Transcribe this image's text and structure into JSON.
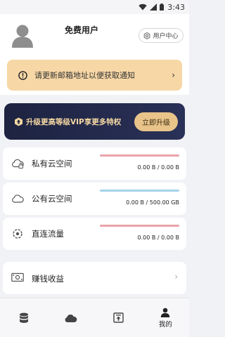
{
  "status_bar": {
    "time": "3:43",
    "icons": [
      "wifi-icon",
      "signal-icon",
      "battery-icon"
    ]
  },
  "profile": {
    "username": "免费用户",
    "user_center_label": "用户中心"
  },
  "notice": {
    "text": "请更新邮箱地址以便获取通知",
    "icon": "exclamation-circle-icon"
  },
  "vip_banner": {
    "text": "升级更高等级VIP享更多特权",
    "button_label": "立即升级"
  },
  "storage": [
    {
      "label": "私有云空间",
      "usage": "0.00 B / 0.00 B",
      "bar_color": "#e9a3a8",
      "fill": 1.0,
      "icon": "private-cloud-icon"
    },
    {
      "label": "公有云空间",
      "usage": "0.00 B / 500.00 GB",
      "bar_color": "#a4d2ea",
      "fill": 1.0,
      "icon": "cloud-icon"
    },
    {
      "label": "直连流量",
      "usage": "0.00 B / 0.00 B",
      "bar_color": "#e9a3a8",
      "fill": 1.0,
      "icon": "traffic-icon"
    }
  ],
  "earnings": {
    "label": "赚钱收益",
    "icon": "money-icon"
  },
  "tabs": [
    {
      "icon": "database-icon",
      "label": ""
    },
    {
      "icon": "cloud-icon",
      "label": ""
    },
    {
      "icon": "upload-icon",
      "label": ""
    },
    {
      "icon": "person-icon",
      "label": "我的",
      "active": true
    }
  ]
}
